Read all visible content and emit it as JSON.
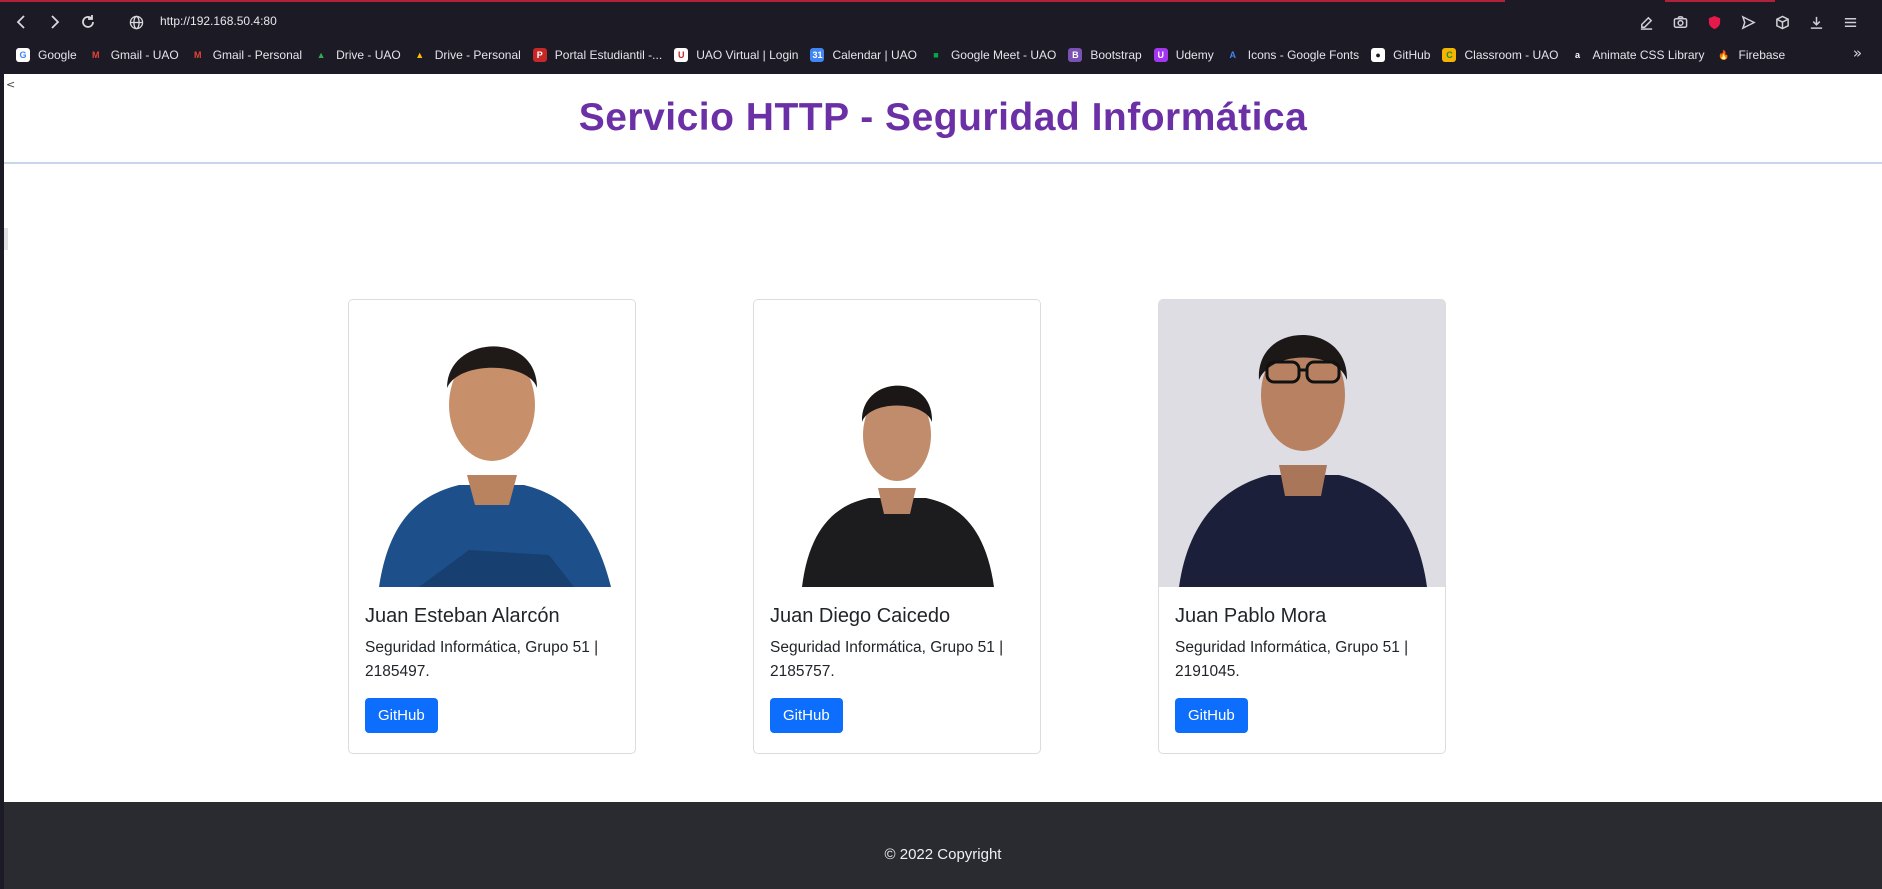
{
  "browser": {
    "url": "http://192.168.50.4:80",
    "bookmarks": [
      {
        "label": "Google",
        "icon": "google-icon",
        "color": "#ffffff",
        "glyph": "G",
        "glyph_color": "#4285f4"
      },
      {
        "label": "Gmail - UAO",
        "icon": "gmail-icon",
        "color": "#1b1a25",
        "glyph": "M",
        "glyph_color": "#ea4335"
      },
      {
        "label": "Gmail - Personal",
        "icon": "gmail-icon",
        "color": "#1b1a25",
        "glyph": "M",
        "glyph_color": "#ea4335"
      },
      {
        "label": "Drive - UAO",
        "icon": "drive-icon",
        "color": "#1b1a25",
        "glyph": "▲",
        "glyph_color": "#34a853"
      },
      {
        "label": "Drive - Personal",
        "icon": "drive-icon",
        "color": "#1b1a25",
        "glyph": "▲",
        "glyph_color": "#fbbc04"
      },
      {
        "label": "Portal Estudiantil -...",
        "icon": "portal-icon",
        "color": "#c62828",
        "glyph": "P",
        "glyph_color": "#ffffff"
      },
      {
        "label": "UAO Virtual | Login",
        "icon": "uao-virtual-icon",
        "color": "#ffffff",
        "glyph": "U",
        "glyph_color": "#c62828"
      },
      {
        "label": "Calendar | UAO",
        "icon": "calendar-icon",
        "color": "#4285f4",
        "glyph": "31",
        "glyph_color": "#ffffff"
      },
      {
        "label": "Google Meet - UAO",
        "icon": "meet-icon",
        "color": "#1b1a25",
        "glyph": "■",
        "glyph_color": "#00ac47"
      },
      {
        "label": "Bootstrap",
        "icon": "bootstrap-icon",
        "color": "#7952b3",
        "glyph": "B",
        "glyph_color": "#ffffff"
      },
      {
        "label": "Udemy",
        "icon": "udemy-icon",
        "color": "#a435f0",
        "glyph": "U",
        "glyph_color": "#ffffff"
      },
      {
        "label": "Icons - Google Fonts",
        "icon": "google-fonts-icon",
        "color": "#1b1a25",
        "glyph": "A",
        "glyph_color": "#4285f4"
      },
      {
        "label": "GitHub",
        "icon": "github-icon",
        "color": "#ffffff",
        "glyph": "●",
        "glyph_color": "#1b1a25"
      },
      {
        "label": "Classroom - UAO",
        "icon": "classroom-icon",
        "color": "#f4b400",
        "glyph": "C",
        "glyph_color": "#1e8e3e"
      },
      {
        "label": "Animate CSS Library",
        "icon": "animate-css-icon",
        "color": "#1b1a25",
        "glyph": "a",
        "glyph_color": "#ffffff"
      },
      {
        "label": "Firebase",
        "icon": "firebase-icon",
        "color": "#1b1a25",
        "glyph": "🔥",
        "glyph_color": "#ffca28"
      }
    ],
    "bookmarks_more": "»"
  },
  "header": {
    "title": "Servicio HTTP - Seguridad Informática",
    "title_color": "#6b2fa6"
  },
  "cards": [
    {
      "name": "Juan Esteban Alarcón",
      "description": "Seguridad Informática, Grupo 51 | 2185497.",
      "button": "GitHub"
    },
    {
      "name": "Juan Diego Caicedo",
      "description": "Seguridad Informática, Grupo 51 | 2185757.",
      "button": "GitHub"
    },
    {
      "name": "Juan Pablo Mora",
      "description": "Seguridad Informática, Grupo 51 | 2191045.",
      "button": "GitHub"
    }
  ],
  "footer": {
    "text": "© 2022 Copyright"
  },
  "colors": {
    "button": "#0d6efd",
    "footer_bg": "#292b30",
    "chrome_bg": "#1b1a25"
  }
}
